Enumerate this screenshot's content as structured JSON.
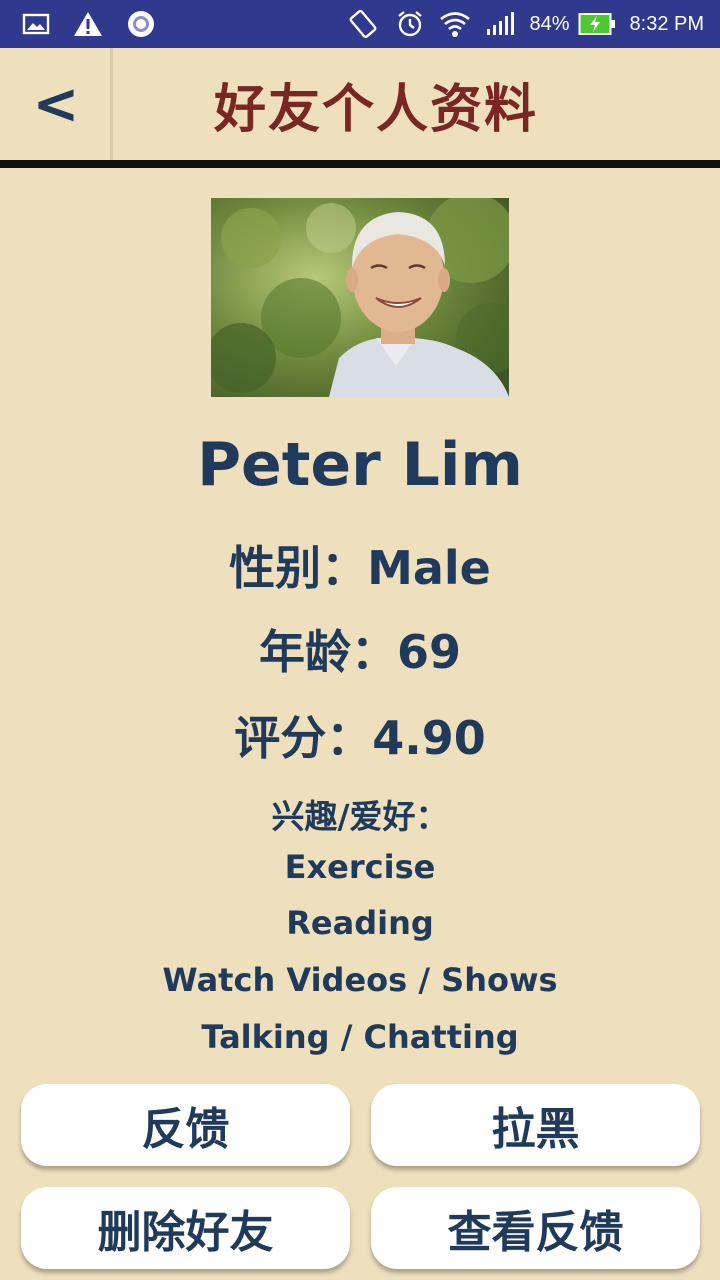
{
  "status_bar": {
    "battery": "84%",
    "time": "8:32 PM"
  },
  "header": {
    "back_label": "<",
    "title": "好友个人资料"
  },
  "profile": {
    "name": "Peter Lim",
    "gender": "性别：Male",
    "age": "年龄：69",
    "rating": "评分：4.90",
    "hobbies_title": "兴趣/爱好：",
    "hobbies": [
      "Exercise",
      "Reading",
      "Watch Videos / Shows",
      "Talking / Chatting"
    ]
  },
  "buttons": {
    "feedback": "反馈",
    "block": "拉黑",
    "delete_friend": "删除好友",
    "view_feedback": "查看反馈"
  },
  "colors": {
    "status_bar": "#2f3a8f",
    "background": "#eedfbd",
    "title": "#7a2622",
    "text": "#1f3a5a"
  }
}
